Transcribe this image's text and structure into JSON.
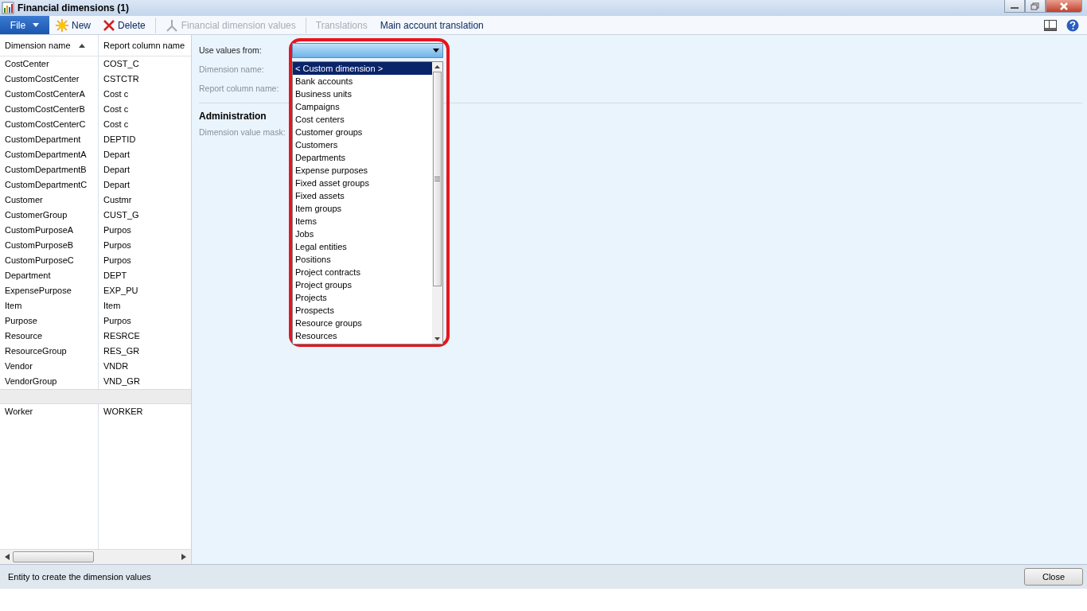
{
  "window": {
    "title": "Financial dimensions (1)"
  },
  "toolbar": {
    "file_menu": "File",
    "buttons": [
      {
        "label": "New",
        "kind": "new",
        "disabled": false
      },
      {
        "label": "Delete",
        "kind": "delete",
        "disabled": false
      },
      {
        "label": "Financial dimension values",
        "kind": "values",
        "disabled": true
      },
      {
        "label": "Translations",
        "kind": "plain",
        "disabled": true
      },
      {
        "label": "Main account translation",
        "kind": "plain",
        "disabled": false
      }
    ]
  },
  "grid": {
    "columns": [
      {
        "label": "Dimension name",
        "sorted": true
      },
      {
        "label": "Report column name",
        "sorted": false
      }
    ],
    "rows": [
      {
        "kind": "data",
        "cells": [
          "CostCenter",
          "COST_C"
        ]
      },
      {
        "kind": "data",
        "cells": [
          "CustomCostCenter",
          "CSTCTR"
        ]
      },
      {
        "kind": "data",
        "cells": [
          "CustomCostCenterA",
          "Cost c"
        ]
      },
      {
        "kind": "data",
        "cells": [
          "CustomCostCenterB",
          "Cost c"
        ]
      },
      {
        "kind": "data",
        "cells": [
          "CustomCostCenterC",
          "Cost c"
        ]
      },
      {
        "kind": "data",
        "cells": [
          "CustomDepartment",
          "DEPTID"
        ]
      },
      {
        "kind": "data",
        "cells": [
          "CustomDepartmentA",
          "Depart"
        ]
      },
      {
        "kind": "data",
        "cells": [
          "CustomDepartmentB",
          "Depart"
        ]
      },
      {
        "kind": "data",
        "cells": [
          "CustomDepartmentC",
          "Depart"
        ]
      },
      {
        "kind": "data",
        "cells": [
          "Customer",
          "Custmr"
        ]
      },
      {
        "kind": "data",
        "cells": [
          "CustomerGroup",
          "CUST_G"
        ]
      },
      {
        "kind": "data",
        "cells": [
          "CustomPurposeA",
          "Purpos"
        ]
      },
      {
        "kind": "data",
        "cells": [
          "CustomPurposeB",
          "Purpos"
        ]
      },
      {
        "kind": "data",
        "cells": [
          "CustomPurposeC",
          "Purpos"
        ]
      },
      {
        "kind": "data",
        "cells": [
          "Department",
          "DEPT"
        ]
      },
      {
        "kind": "data",
        "cells": [
          "ExpensePurpose",
          "EXP_PU"
        ]
      },
      {
        "kind": "data",
        "cells": [
          "Item",
          "Item"
        ]
      },
      {
        "kind": "data",
        "cells": [
          "Purpose",
          "Purpos"
        ]
      },
      {
        "kind": "data",
        "cells": [
          "Resource",
          "RESRCE"
        ]
      },
      {
        "kind": "data",
        "cells": [
          "ResourceGroup",
          "RES_GR"
        ]
      },
      {
        "kind": "data",
        "cells": [
          "Vendor",
          "VNDR"
        ]
      },
      {
        "kind": "data",
        "cells": [
          "VendorGroup",
          "VND_GR"
        ]
      },
      {
        "kind": "empty"
      },
      {
        "kind": "data",
        "cells": [
          "Worker",
          "WORKER"
        ]
      }
    ]
  },
  "form": {
    "fields": [
      {
        "label": "Use values from:",
        "disabled": false
      },
      {
        "label": "Dimension name:",
        "disabled": true
      },
      {
        "label": "Report column name:",
        "disabled": true
      }
    ],
    "section_title": "Administration",
    "section_fields": [
      {
        "label": "Dimension value mask:",
        "disabled": true
      }
    ]
  },
  "dropdown": {
    "highlighted": true,
    "options": [
      {
        "label": "< Custom dimension >",
        "selected": true
      },
      {
        "label": "Bank accounts",
        "selected": false
      },
      {
        "label": "Business units",
        "selected": false
      },
      {
        "label": "Campaigns",
        "selected": false
      },
      {
        "label": "Cost centers",
        "selected": false
      },
      {
        "label": "Customer groups",
        "selected": false
      },
      {
        "label": "Customers",
        "selected": false
      },
      {
        "label": "Departments",
        "selected": false
      },
      {
        "label": "Expense purposes",
        "selected": false
      },
      {
        "label": "Fixed asset groups",
        "selected": false
      },
      {
        "label": "Fixed assets",
        "selected": false
      },
      {
        "label": "Item groups",
        "selected": false
      },
      {
        "label": "Items",
        "selected": false
      },
      {
        "label": "Jobs",
        "selected": false
      },
      {
        "label": "Legal entities",
        "selected": false
      },
      {
        "label": "Positions",
        "selected": false
      },
      {
        "label": "Project contracts",
        "selected": false
      },
      {
        "label": "Project groups",
        "selected": false
      },
      {
        "label": "Projects",
        "selected": false
      },
      {
        "label": "Prospects",
        "selected": false
      },
      {
        "label": "Resource groups",
        "selected": false
      },
      {
        "label": "Resources",
        "selected": false
      }
    ]
  },
  "status_bar": {
    "text": "Entity to create the dimension values",
    "button": "Close"
  }
}
